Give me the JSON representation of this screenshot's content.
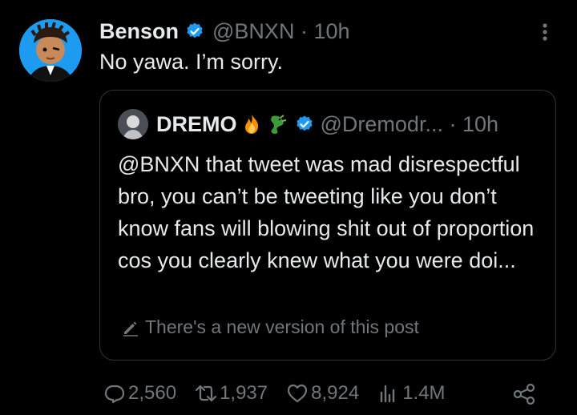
{
  "author": {
    "name": "Benson",
    "handle": "@BNXN · 10h",
    "verified": true,
    "avatar_icon": "cartoon-avatar"
  },
  "tweet": {
    "text": "No yawa. I’m sorry."
  },
  "quote": {
    "name": "DREMO",
    "emojis": [
      "fire-emoji",
      "dragon-emoji"
    ],
    "verified": true,
    "handle": "@Dremodr... · 10h",
    "text": "@BNXN that tweet was mad disrespectful bro, you can’t be tweeting like you don’t know fans will blowing shit out of proportion cos you clearly knew what you were doi...",
    "note": "There's a new version of this post"
  },
  "actions": {
    "replies": "2,560",
    "reposts": "1,937",
    "likes": "8,924",
    "views": "1.4M"
  },
  "colors": {
    "background": "#000000",
    "text": "#e7e9ea",
    "muted": "#71767b",
    "verified": "#1d9bf0",
    "border": "#2f3336"
  }
}
